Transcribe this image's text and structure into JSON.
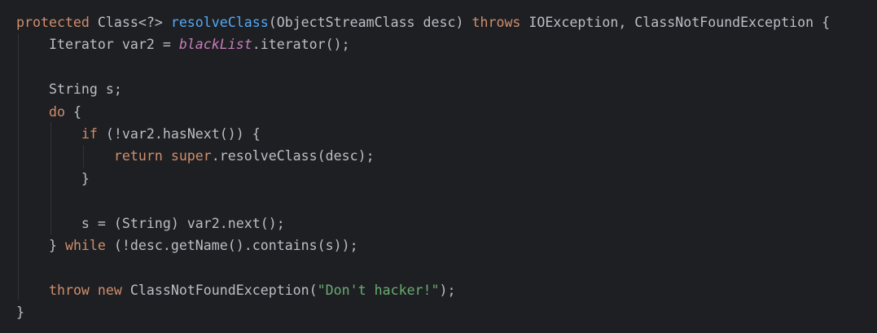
{
  "editor": {
    "colors": {
      "background": "#1e1f22",
      "text": "#bcbec4",
      "keyword": "#cf8e6d",
      "method": "#56a8f5",
      "static_field": "#c77dbb",
      "string": "#6aab73"
    },
    "lines": [
      [
        {
          "t": "protected",
          "c": "kw"
        },
        {
          "t": " Class<?> "
        },
        {
          "t": "resolveClass",
          "c": "fn"
        },
        {
          "t": "(ObjectStreamClass desc) "
        },
        {
          "t": "throws",
          "c": "kw"
        },
        {
          "t": " IOException, ClassNotFoundException {"
        }
      ],
      [
        {
          "t": "    Iterator var2 = "
        },
        {
          "t": "blackList",
          "c": "st"
        },
        {
          "t": ".iterator();"
        }
      ],
      [],
      [
        {
          "t": "    String s;"
        }
      ],
      [
        {
          "t": "    "
        },
        {
          "t": "do",
          "c": "kw"
        },
        {
          "t": " {"
        }
      ],
      [
        {
          "t": "        "
        },
        {
          "t": "if",
          "c": "kw"
        },
        {
          "t": " (!var2.hasNext()) {"
        }
      ],
      [
        {
          "t": "            "
        },
        {
          "t": "return super",
          "c": "kw"
        },
        {
          "t": ".resolveClass(desc);"
        }
      ],
      [
        {
          "t": "        }"
        }
      ],
      [],
      [
        {
          "t": "        s = (String) var2.next();"
        }
      ],
      [
        {
          "t": "    } "
        },
        {
          "t": "while",
          "c": "kw"
        },
        {
          "t": " (!desc.getName().contains(s));"
        }
      ],
      [],
      [
        {
          "t": "    "
        },
        {
          "t": "throw new",
          "c": "kw"
        },
        {
          "t": " ClassNotFoundException("
        },
        {
          "t": "\"Don't hacker!\"",
          "c": "str"
        },
        {
          "t": ");"
        }
      ],
      [
        {
          "t": "}"
        }
      ]
    ]
  }
}
